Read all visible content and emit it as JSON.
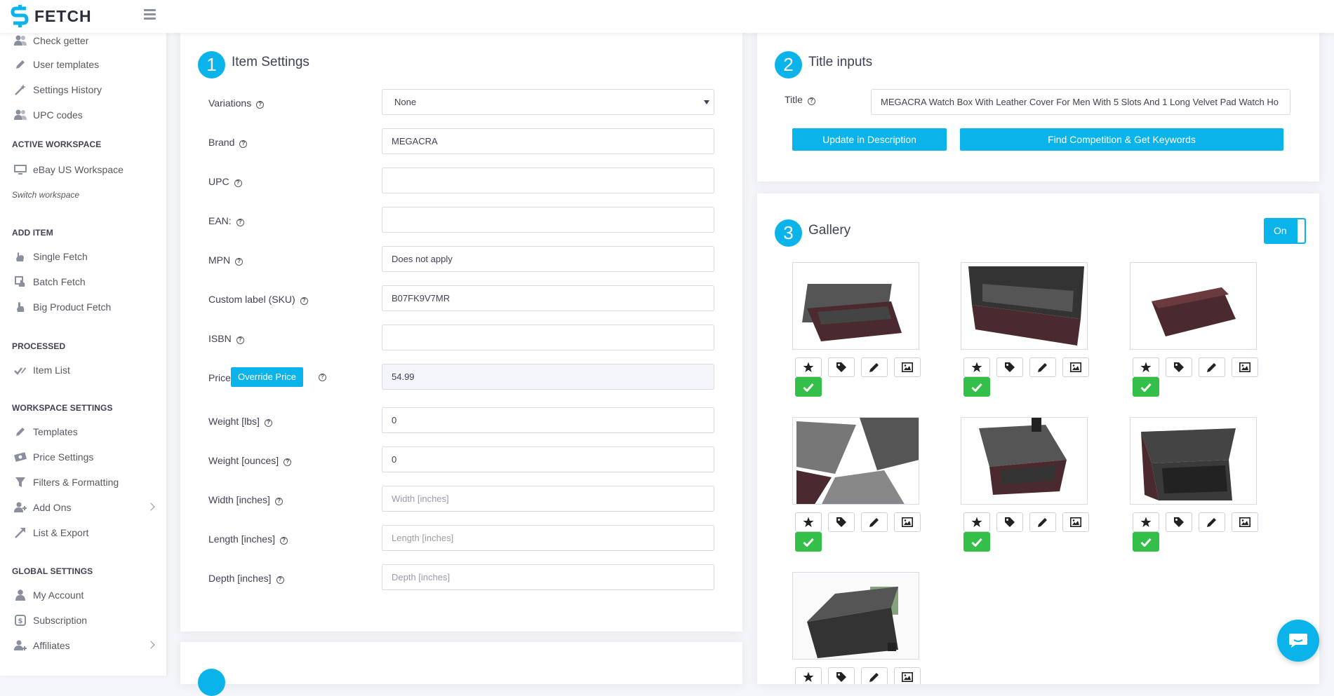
{
  "app": {
    "brand": "FETCH"
  },
  "sidebar": {
    "top_items": [
      {
        "label": "Check getter",
        "icon": "users-icon"
      },
      {
        "label": "User templates",
        "icon": "edit-icon"
      },
      {
        "label": "Settings History",
        "icon": "wand-icon"
      },
      {
        "label": "UPC codes",
        "icon": "users-icon"
      }
    ],
    "active_workspace": {
      "title": "ACTIVE WORKSPACE",
      "name": "eBay US Workspace",
      "switch": "Switch workspace"
    },
    "add_item": {
      "title": "ADD ITEM",
      "items": [
        "Single Fetch",
        "Batch Fetch",
        "Big Product Fetch"
      ]
    },
    "processed": {
      "title": "PROCESSED",
      "items": [
        "Item List"
      ]
    },
    "workspace_settings": {
      "title": "WORKSPACE SETTINGS",
      "items": [
        "Templates",
        "Price Settings",
        "Filters & Formatting",
        "Add Ons",
        "List & Export"
      ]
    },
    "global_settings": {
      "title": "GLOBAL SETTINGS",
      "items": [
        "My Account",
        "Subscription",
        "Affiliates"
      ]
    }
  },
  "item_settings": {
    "number": "1",
    "title": "Item Settings",
    "override_label": "Override Price",
    "fields": {
      "variations": {
        "label": "Variations",
        "value": "None"
      },
      "brand": {
        "label": "Brand",
        "value": "MEGACRA"
      },
      "upc": {
        "label": "UPC",
        "value": ""
      },
      "ean": {
        "label": "EAN:",
        "value": ""
      },
      "mpn": {
        "label": "MPN",
        "value": "Does not apply"
      },
      "sku": {
        "label": "Custom label (SKU)",
        "value": "B07FK9V7MR"
      },
      "isbn": {
        "label": "ISBN",
        "value": ""
      },
      "price": {
        "label": "Price",
        "value": "54.99"
      },
      "weight_lbs": {
        "label": "Weight [lbs]",
        "value": "0"
      },
      "weight_oz": {
        "label": "Weight [ounces]",
        "value": "0"
      },
      "width": {
        "label": "Width [inches]",
        "placeholder": "Width [inches]"
      },
      "length": {
        "label": "Length [inches]",
        "placeholder": "Length [inches]"
      },
      "depth": {
        "label": "Depth [inches]",
        "placeholder": "Depth [inches]"
      }
    }
  },
  "title_inputs": {
    "number": "2",
    "title": "Title inputs",
    "label": "Title",
    "value": "MEGACRA Watch Box With Leather Cover For Men With 5 Slots And 1 Long Velvet Pad Watch Ho",
    "update_button": "Update in Description",
    "find_button": "Find Competition & Get Keywords"
  },
  "gallery": {
    "number": "3",
    "title": "Gallery",
    "toggle": "On",
    "image_count": 7
  },
  "colors": {
    "accent": "#0ab4eb",
    "success": "#34bf49",
    "box": "#4a2a2e"
  }
}
